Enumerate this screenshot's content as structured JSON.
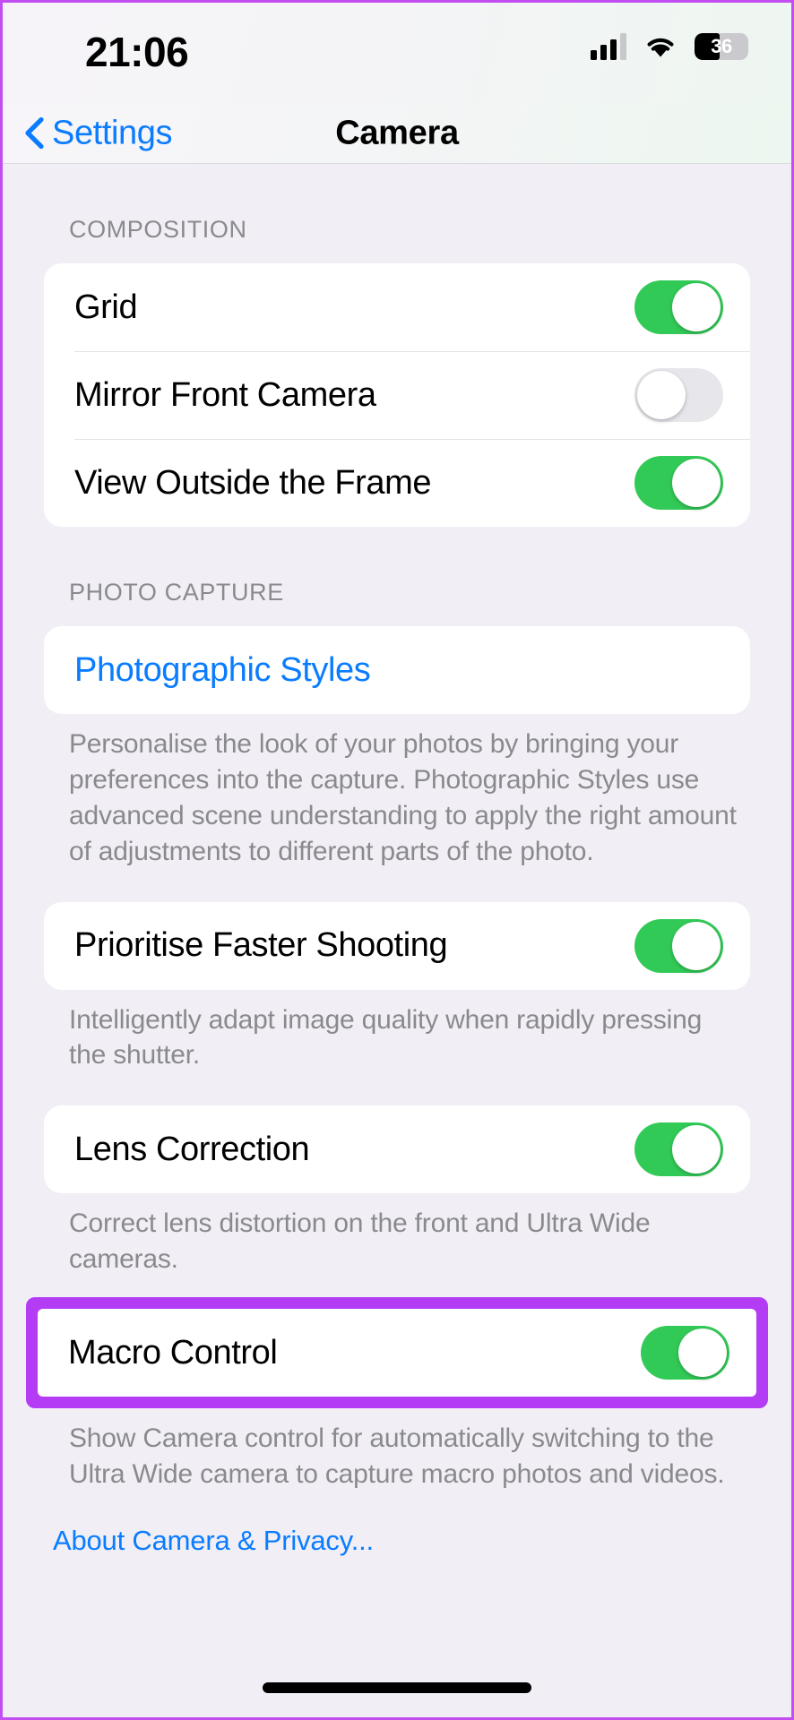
{
  "status_bar": {
    "time": "21:06",
    "cellular_icon": "signal-bars-icon",
    "cellular_bars_filled": 3,
    "cellular_bars_total": 4,
    "wifi_icon": "wifi-icon",
    "battery_icon": "battery-icon",
    "battery_percent": "36",
    "battery_level": 36
  },
  "nav": {
    "back_icon": "chevron-left-icon",
    "back_label": "Settings",
    "title": "Camera"
  },
  "sections": {
    "composition": {
      "header": "COMPOSITION",
      "rows": [
        {
          "label": "Grid",
          "toggle": "on"
        },
        {
          "label": "Mirror Front Camera",
          "toggle": "off"
        },
        {
          "label": "View Outside the Frame",
          "toggle": "on"
        }
      ]
    },
    "photo_capture": {
      "header": "PHOTO CAPTURE",
      "photographic_styles": {
        "label": "Photographic Styles"
      },
      "photographic_styles_note": "Personalise the look of your photos by bringing your preferences into the capture. Photographic Styles use advanced scene understanding to apply the right amount of adjustments to different parts of the photo.",
      "prioritise": {
        "label": "Prioritise Faster Shooting",
        "toggle": "on"
      },
      "prioritise_note": "Intelligently adapt image quality when rapidly pressing the shutter.",
      "lens_correction": {
        "label": "Lens Correction",
        "toggle": "on"
      },
      "lens_correction_note": "Correct lens distortion on the front and Ultra Wide cameras.",
      "macro_control": {
        "label": "Macro Control",
        "toggle": "on"
      },
      "macro_control_note": "Show Camera control for automatically switching to the Ultra Wide camera to capture macro photos and videos."
    }
  },
  "about_link": "About Camera & Privacy...",
  "colors": {
    "toggle_on": "#32ca57",
    "toggle_off": "#e6e6eb",
    "link_blue": "#0a7cff",
    "highlight_purple": "#b43cf5",
    "page_background": "#f1eff5",
    "card_background": "#ffffff",
    "secondary_text": "#8a8a8e"
  }
}
